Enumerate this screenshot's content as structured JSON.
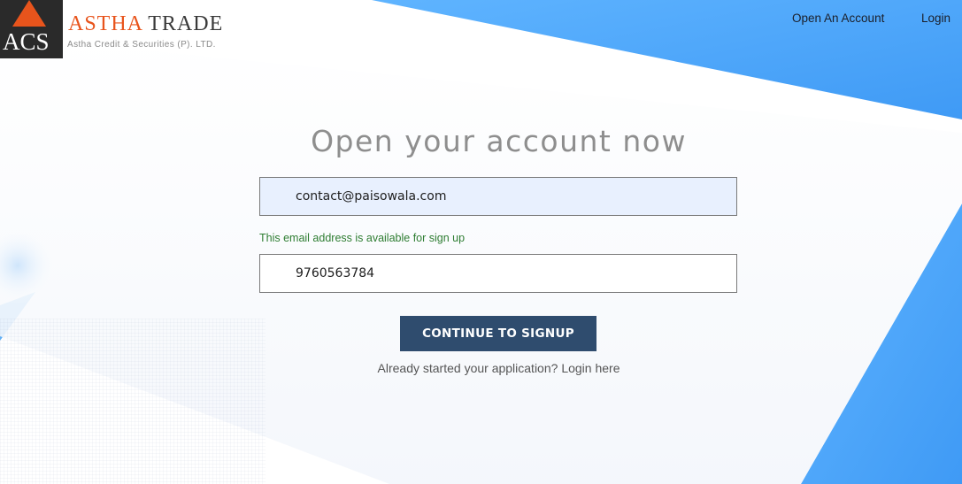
{
  "brand": {
    "logo_text": "ACS",
    "name_part1": "ASTHA",
    "name_part2": "TRADE",
    "subtitle": "Astha Credit & Securities (P). LTD."
  },
  "nav": {
    "open_account": "Open An Account",
    "login": "Login"
  },
  "form": {
    "heading": "Open your account now",
    "email_value": "contact@paisowala.com",
    "email_hint": "This email address is available for sign up",
    "phone_value": "9760563784",
    "submit_label": "CONTINUE TO SIGNUP",
    "already_text": "Already started your application?",
    "login_link": "Login here"
  },
  "colors": {
    "accent": "#e8541c",
    "button": "#2f4c6e",
    "background_blue": "#4aa8ff",
    "success_text": "#2e7d32"
  }
}
